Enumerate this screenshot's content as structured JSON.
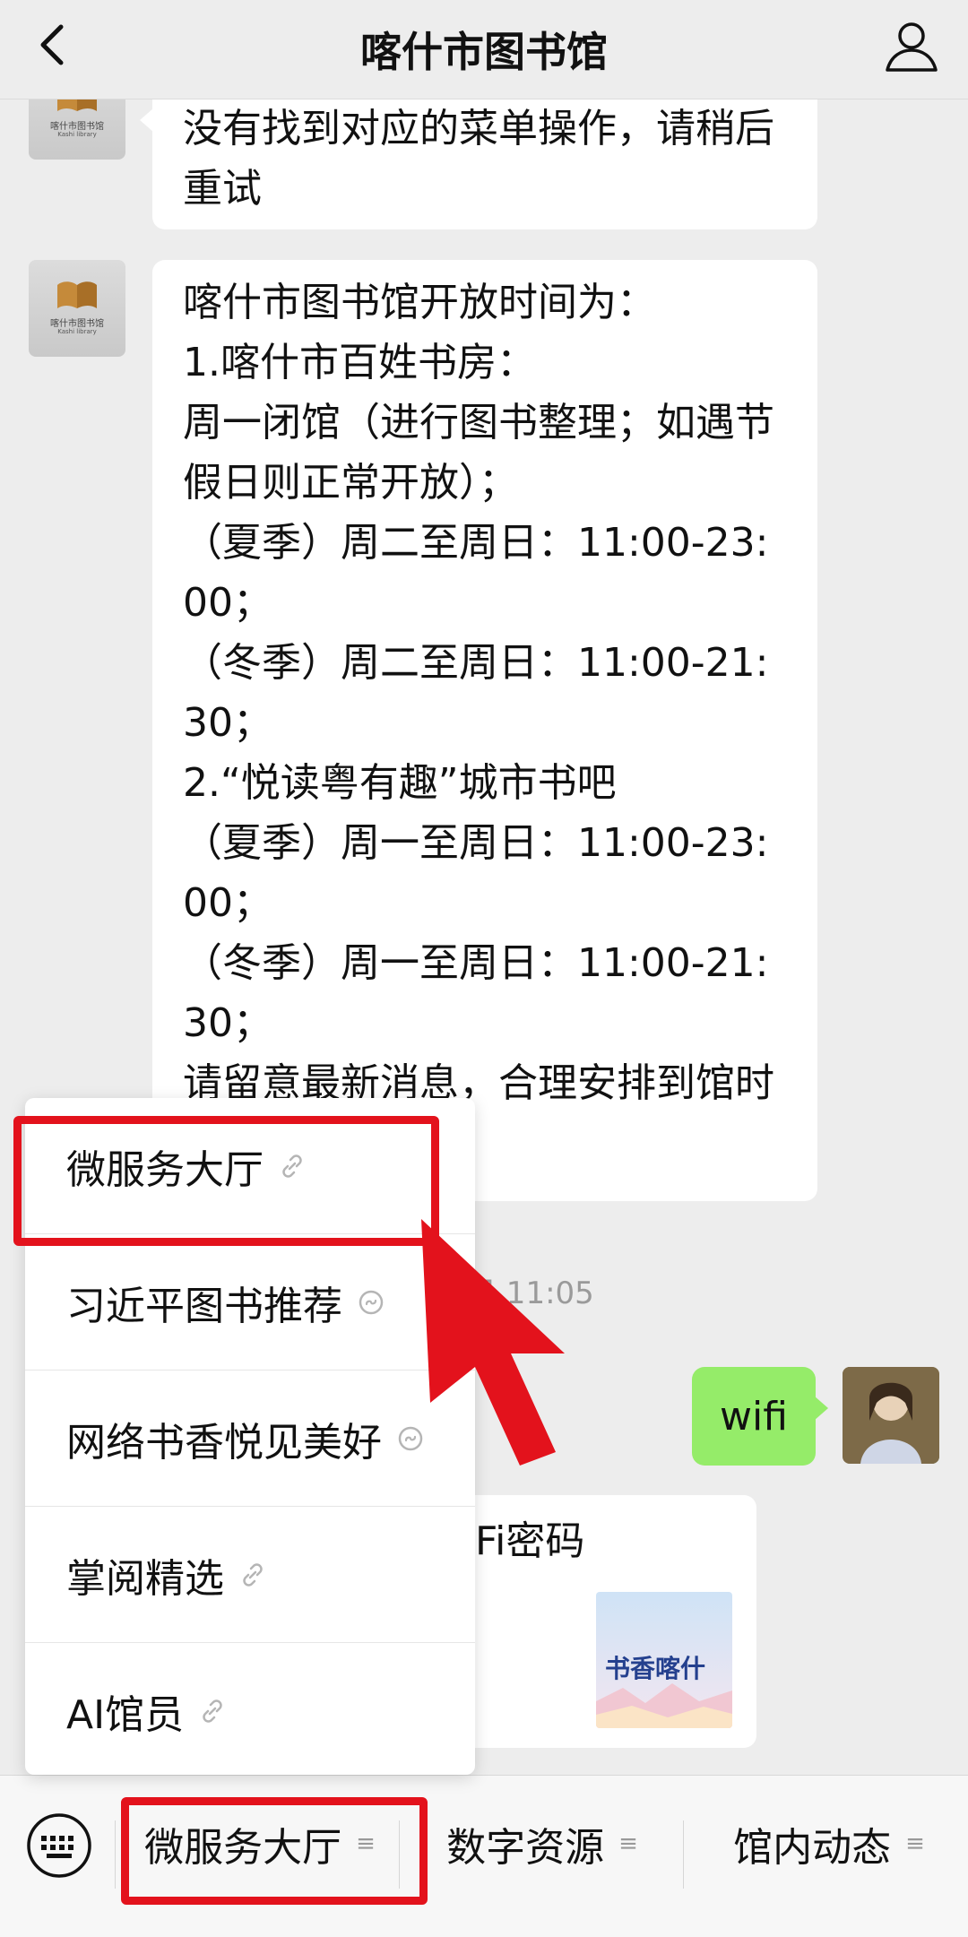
{
  "header": {
    "title": "喀什市图书馆"
  },
  "library_avatar": {
    "logo_text": "喀什市图书馆",
    "logo_subtext": "Kashi library"
  },
  "messages": {
    "msg1": {
      "lines": [
        "没有找到对应的菜单操作，请稍后",
        "重试"
      ]
    },
    "msg2": {
      "lines": [
        "喀什市图书馆开放时间为：",
        "1.喀什市百姓书房：",
        "周一闭馆（进行图书整理；如遇节",
        "假日则正常开放）；",
        "（夏季）周二至周日：11:00-23:",
        "00；",
        "（冬季）周二至周日：11:00-21:",
        "30；",
        "2.“悦读粤有趣”城市书吧",
        "（夏季）周一至周日：11:00-23:",
        "00；",
        "（冬季）周一至周日：11:00-21:",
        "30；",
        "请留意最新消息，合理安排到馆时"
      ]
    },
    "timestamp": "日 11:05",
    "user_msg": "wifi",
    "reply_partial": "Fi密码",
    "reply_card_logo": "书香喀什"
  },
  "popup_menu": {
    "items": [
      {
        "label": "微服务大厅",
        "icon": "link-icon"
      },
      {
        "label": "习近平图书推荐",
        "icon": "mini-program-icon"
      },
      {
        "label": "网络书香悦见美好",
        "icon": "mini-program-icon"
      },
      {
        "label": "掌阅精选",
        "icon": "link-icon"
      },
      {
        "label": "AI馆员",
        "icon": "link-icon"
      }
    ]
  },
  "bottom_menu": {
    "tabs": [
      {
        "label": "微服务大厅"
      },
      {
        "label": "数字资源"
      },
      {
        "label": "馆内动态"
      }
    ]
  },
  "colors": {
    "annotation_red": "#e3121c",
    "user_bubble": "#95ec69",
    "background": "#ededed"
  }
}
